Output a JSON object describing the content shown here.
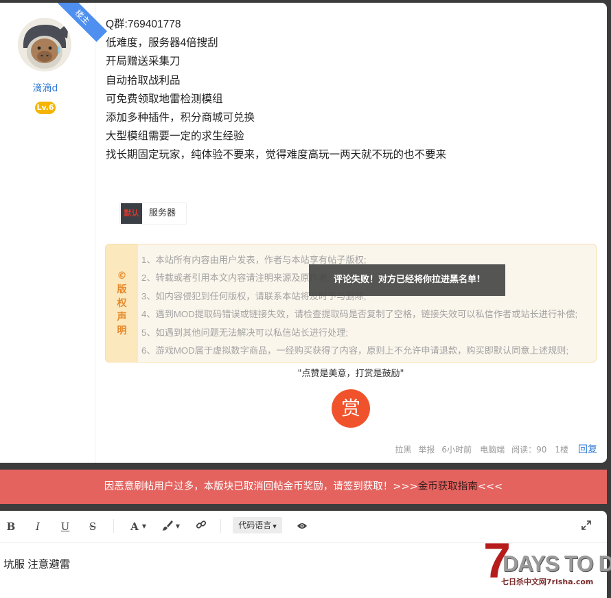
{
  "author": {
    "floor_badge": "楼主",
    "name": "滴滴d",
    "level": "Lv.6"
  },
  "post": {
    "lines": [
      "Q群:769401778",
      "低难度，服务器4倍搜刮",
      "开局赠送采集刀",
      "自动拾取战利品",
      "可免费领取地雷检测模组",
      "添加多种插件，积分商城可兑换",
      "大型模组需要一定的求生经验",
      "找长期固定玩家，纯体验不要来，觉得难度高玩一两天就不玩的也不要来"
    ],
    "tag": {
      "thumb_text": "默认",
      "label": "服务器"
    }
  },
  "copyright": {
    "symbol": "©",
    "title_chars": [
      "版",
      "权",
      "声",
      "明"
    ],
    "rules": [
      "1、本站所有内容由用户发表，作者与本站享有帖子版权;",
      "2、转载或者引用本文内容请注明来源及原作者;",
      "3、如内容侵犯到任何版权，请联系本站将及时予与删除;",
      "4、遇到MOD提取码错误或链接失效，请检查提取码是否复制了空格，链接失效可以私信作者或站长进行补偿;",
      "5、如遇到其他问题无法解决可以私信站长进行处理;",
      "6、游戏MOD属于虚拟数字商品，一经购买获得了内容，原则上不允许申请退款，购买即默认同意上述规则;"
    ]
  },
  "toast": "评论失败！对方已经将你拉进黑名单!",
  "reward": {
    "slogan": "\"点赞是美意，打赏是鼓励\"",
    "button": "赏"
  },
  "meta": {
    "block": "拉黑",
    "report": "举报",
    "time": "6小时前",
    "device": "电脑端",
    "reads": "阅读：90",
    "floor": "1楼",
    "reply": "回复"
  },
  "notice": {
    "text": "因恶意刷帖用户过多，本版块已取消回帖金币奖励，请签到获取！>>>",
    "link": "金币获取指南",
    "suffix": "<<<"
  },
  "editor": {
    "bold": "B",
    "italic": "I",
    "underline": "U",
    "strike": "S",
    "font_color": "A",
    "code_language": "代码语言",
    "content": "坑服  注意避雷"
  },
  "watermark": {
    "numeral": "7",
    "title": "DAYS TO DIE",
    "sub": "七日杀中文网7risha.com"
  },
  "colors": {
    "accent_blue": "#2f7ad6",
    "notice_red": "#e4635f",
    "reward_orange": "#f0532b",
    "level_gold": "#f5b400"
  }
}
